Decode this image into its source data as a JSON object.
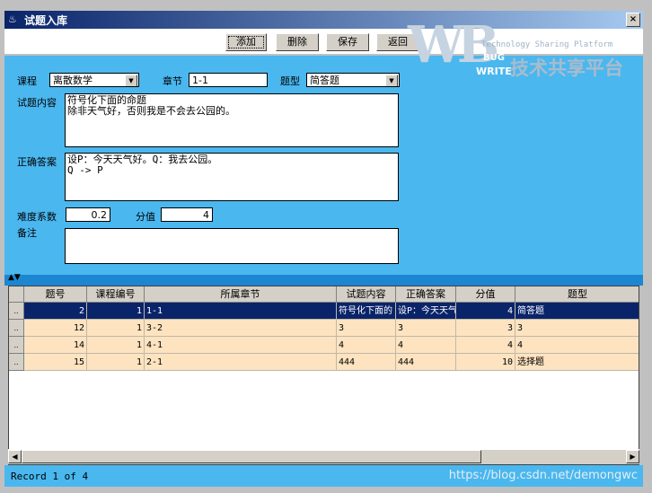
{
  "window": {
    "title": "试题入库",
    "close": "×"
  },
  "toolbar": {
    "add": "添加",
    "delete": "删除",
    "save": "保存",
    "back": "返回"
  },
  "watermark": {
    "letters": "WB",
    "tagline": "Technology Sharing Platform",
    "bug": "BUG",
    "write": "WRITE",
    "cn": "技术共享平台"
  },
  "form": {
    "course_label": "课程",
    "course_value": "离散数学",
    "chapter_label": "章节",
    "chapter_value": "1-1",
    "type_label": "题型",
    "type_value": "简答题",
    "content_label": "试题内容",
    "content_lines": [
      "符号化下面的命题",
      "除非天气好，否则我是不会去公园的。"
    ],
    "answer_label": "正确答案",
    "answer_lines": [
      "设P：今天天气好。Q：我去公园。",
      "Q -> P"
    ],
    "difficulty_label": "难度系数",
    "difficulty_value": "0.2",
    "score_label": "分值",
    "score_value": "4",
    "remark_label": "备注",
    "remark_value": ""
  },
  "grid": {
    "columns": [
      "题号",
      "课程编号",
      "所属章节",
      "试题内容",
      "正确答案",
      "分值",
      "题型"
    ],
    "rows": [
      {
        "id": "2",
        "course": "1",
        "chapter": "1-1",
        "content": "符号化下面的",
        "answer": "设P：今天天气",
        "score": "4",
        "type": "简答题"
      },
      {
        "id": "12",
        "course": "1",
        "chapter": "3-2",
        "content": "3",
        "answer": "3",
        "score": "3",
        "type": "3"
      },
      {
        "id": "14",
        "course": "1",
        "chapter": "4-1",
        "content": "4",
        "answer": "4",
        "score": "4",
        "type": "4"
      },
      {
        "id": "15",
        "course": "1",
        "chapter": "2-1",
        "content": "444",
        "answer": "444",
        "score": "10",
        "type": "选择题"
      }
    ],
    "selector": ".."
  },
  "status": {
    "record": "Record 1 of 4",
    "url": "https://blog.csdn.net/demongwc"
  },
  "colors": {
    "form_bg": "#4ab7ef",
    "row_selected": "#0a246a",
    "row_normal": "#fde3c0"
  }
}
